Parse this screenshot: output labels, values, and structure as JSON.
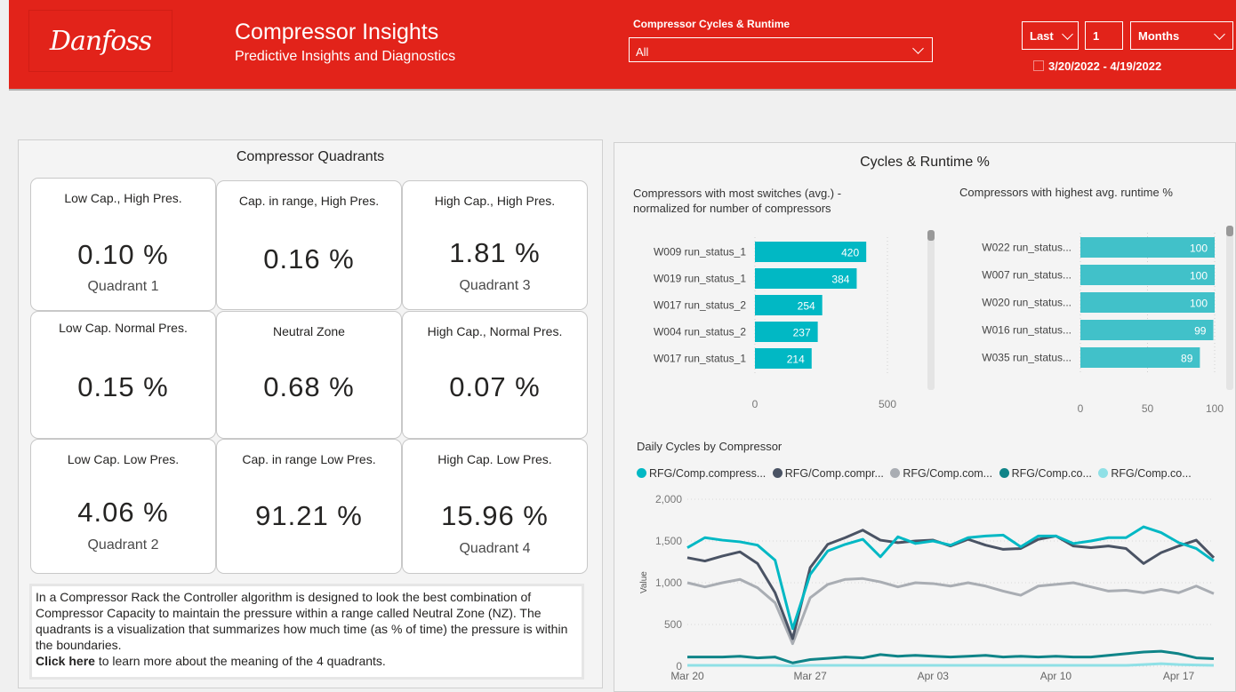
{
  "header": {
    "logo_text": "Danfoss",
    "title": "Compressor Insights",
    "subtitle": "Predictive Insights and Diagnostics",
    "filter_label": "Compressor Cycles & Runtime",
    "filter_value": "All",
    "date_relative": "Last",
    "date_count": "1",
    "date_unit": "Months",
    "date_range": "3/20/2022 - 4/19/2022",
    "accent_color": "#e2231a"
  },
  "quadrants_panel": {
    "title": "Compressor Quadrants",
    "cards": [
      {
        "label": "Low Cap., High Pres.",
        "value": "0.10 %",
        "quadrant": "Quadrant 1"
      },
      {
        "label": "Cap. in  range, High Pres.",
        "value": "0.16 %",
        "quadrant": ""
      },
      {
        "label": "High Cap., High Pres.",
        "value": "1.81 %",
        "quadrant": "Quadrant 3"
      },
      {
        "label": "Low Cap. Normal Pres.",
        "value": "0.15 %",
        "quadrant": ""
      },
      {
        "label": "Neutral Zone",
        "value": "0.68 %",
        "quadrant": ""
      },
      {
        "label": "High Cap., Normal Pres.",
        "value": "0.07 %",
        "quadrant": ""
      },
      {
        "label": "Low Cap. Low Pres.",
        "value": "4.06 %",
        "quadrant": "Quadrant 2"
      },
      {
        "label": "Cap. in range Low Pres.",
        "value": "91.21 %",
        "quadrant": ""
      },
      {
        "label": "High Cap. Low Pres.",
        "value": "15.96 %",
        "quadrant": "Quadrant 4"
      }
    ],
    "note_text": "In a Compressor Rack the Controller algorithm is designed to look the best combination of Compressor Capacity to maintain the pressure within a range called Neutral Zone (NZ). The quadrants is a visualization that summarizes how much time (as % of time) the pressure is within the boundaries.",
    "note_link": "Click here",
    "note_link_suffix": " to learn more about the meaning of the 4 quadrants."
  },
  "cycles_panel": {
    "title": "Cycles & Runtime %"
  },
  "chart_data": [
    {
      "type": "bar",
      "orientation": "horizontal",
      "title": "Compressors with most switches (avg.) - normalized for number of compressors",
      "categories": [
        "W009 run_status_1",
        "W019 run_status_1",
        "W017 run_status_2",
        "W004 run_status_2",
        "W017 run_status_1"
      ],
      "values": [
        420,
        384,
        254,
        237,
        214
      ],
      "xlim": [
        0,
        500
      ],
      "x_ticks": [
        "0",
        "500"
      ],
      "color": "#01b8c4"
    },
    {
      "type": "bar",
      "orientation": "horizontal",
      "title": "Compressors with highest avg. runtime %",
      "categories": [
        "W022 run_status...",
        "W007 run_status...",
        "W020 run_status...",
        "W016 run_status...",
        "W035 run_status..."
      ],
      "values": [
        100,
        100,
        100,
        99,
        89
      ],
      "xlim": [
        0,
        100
      ],
      "x_ticks": [
        "0",
        "50",
        "100"
      ],
      "color": "#41c1c9"
    },
    {
      "type": "line",
      "title": "Daily Cycles by Compressor",
      "ylabel": "Value",
      "ylim": [
        0,
        2000
      ],
      "y_ticks": [
        "0",
        "500",
        "1,000",
        "1,500",
        "2,000"
      ],
      "x_tick_labels": [
        "Mar 20",
        "Mar 27",
        "Apr 03",
        "Apr 10",
        "Apr 17"
      ],
      "x": [
        "3/20",
        "3/21",
        "3/22",
        "3/23",
        "3/24",
        "3/25",
        "3/26",
        "3/27",
        "3/28",
        "3/29",
        "3/30",
        "3/31",
        "4/01",
        "4/02",
        "4/03",
        "4/04",
        "4/05",
        "4/06",
        "4/07",
        "4/08",
        "4/09",
        "4/10",
        "4/11",
        "4/12",
        "4/13",
        "4/14",
        "4/15",
        "4/16",
        "4/17",
        "4/18"
      ],
      "series": [
        {
          "name": "RFG/Comp.compress...",
          "color": "#01b8c4",
          "values": [
            1420,
            1540,
            1510,
            1490,
            1450,
            1270,
            450,
            1100,
            1380,
            1460,
            1520,
            1310,
            1550,
            1470,
            1500,
            1450,
            1540,
            1560,
            1570,
            1430,
            1560,
            1560,
            1470,
            1500,
            1540,
            1540,
            1670,
            1600,
            1480,
            1410,
            1260
          ]
        },
        {
          "name": "RFG/Comp.compr...",
          "color": "#4a5364",
          "values": [
            1300,
            1260,
            1320,
            1370,
            1230,
            880,
            330,
            1180,
            1460,
            1540,
            1630,
            1510,
            1480,
            1500,
            1510,
            1440,
            1520,
            1450,
            1400,
            1410,
            1520,
            1560,
            1440,
            1420,
            1440,
            1410,
            1230,
            1360,
            1440,
            1510,
            1300
          ]
        },
        {
          "name": "RFG/Comp.com...",
          "color": "#a9adb3",
          "values": [
            1000,
            950,
            1000,
            1040,
            940,
            760,
            270,
            820,
            980,
            1040,
            1050,
            1010,
            950,
            1000,
            990,
            960,
            1000,
            960,
            900,
            850,
            960,
            980,
            1000,
            950,
            900,
            910,
            880,
            920,
            880,
            960,
            870
          ]
        },
        {
          "name": "RFG/Comp.co...",
          "color": "#0f8488",
          "values": [
            110,
            110,
            110,
            120,
            100,
            110,
            40,
            80,
            95,
            110,
            100,
            140,
            120,
            130,
            120,
            110,
            120,
            130,
            110,
            120,
            110,
            120,
            110,
            110,
            130,
            150,
            170,
            180,
            150,
            100,
            90
          ]
        },
        {
          "name": "RFG/Comp.co...",
          "color": "#8fe0e6",
          "values": [
            10,
            10,
            10,
            10,
            10,
            10,
            5,
            10,
            10,
            10,
            10,
            10,
            10,
            10,
            10,
            10,
            10,
            10,
            10,
            10,
            10,
            10,
            10,
            10,
            10,
            10,
            20,
            30,
            20,
            15,
            10
          ]
        }
      ]
    }
  ]
}
